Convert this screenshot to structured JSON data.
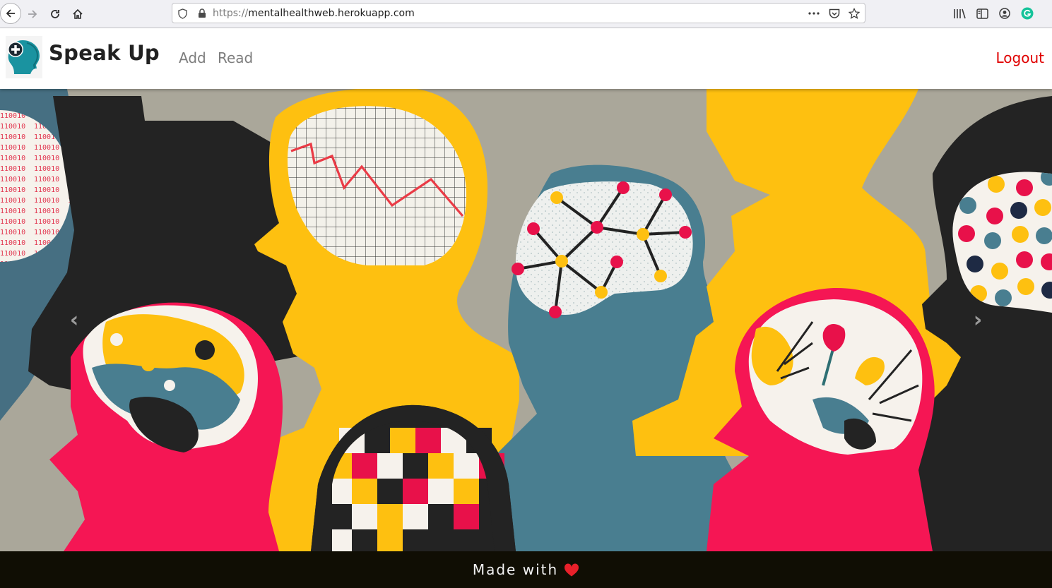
{
  "browser": {
    "url_scheme": "https://",
    "url_host": "mentalhealthweb.herokuapp.com",
    "icons": [
      "back-arrow-icon",
      "forward-arrow-icon",
      "reload-icon",
      "home-icon",
      "shield-icon",
      "lock-icon",
      "more-dots-icon",
      "pocket-icon",
      "bookmark-star-icon",
      "library-icon",
      "sidebar-icon",
      "account-icon",
      "grammarly-icon"
    ]
  },
  "header": {
    "brand": "Speak Up",
    "nav": {
      "add": "Add",
      "read": "Read"
    },
    "logout": "Logout",
    "colors": {
      "logout": "#e00000",
      "brand": "#212121",
      "nav": "#7d7d7d"
    }
  },
  "carousel": {
    "prev_icon": "chevron-left-icon",
    "next_icon": "chevron-right-icon",
    "prev_glyph": "‹",
    "next_glyph": "›"
  },
  "footer": {
    "text": "Made with",
    "icon": "heart-icon",
    "colors": {
      "background": "#100e04",
      "heart": "#e8202a"
    }
  }
}
